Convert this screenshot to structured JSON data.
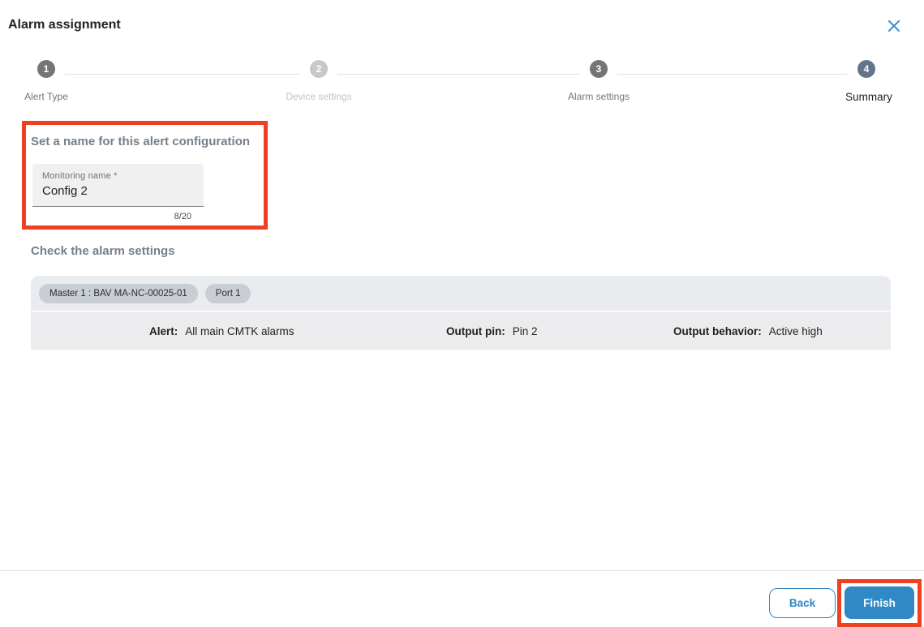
{
  "dialog": {
    "title": "Alarm assignment"
  },
  "stepper": {
    "steps": [
      {
        "number": "1",
        "label": "Alert Type",
        "state": "completed"
      },
      {
        "number": "2",
        "label": "Device settings",
        "state": "disabled"
      },
      {
        "number": "3",
        "label": "Alarm settings",
        "state": "completed"
      },
      {
        "number": "4",
        "label": "Summary",
        "state": "active"
      }
    ]
  },
  "name_section": {
    "heading": "Set a name for this alert configuration",
    "field": {
      "label": "Monitoring name *",
      "value": "Config 2",
      "counter": "8/20"
    }
  },
  "settings_section": {
    "heading": "Check the alarm settings",
    "chips": [
      "Master 1 : BAV MA-NC-00025-01",
      "Port 1"
    ],
    "details": [
      {
        "label": "Alert:",
        "value": "All main CMTK alarms"
      },
      {
        "label": "Output pin:",
        "value": "Pin 2"
      },
      {
        "label": "Output behavior:",
        "value": "Active high"
      }
    ]
  },
  "footer": {
    "back_label": "Back",
    "finish_label": "Finish"
  },
  "colors": {
    "accent_blue": "#3089c4",
    "annotation_red": "#ee4023",
    "step_completed": "#757575",
    "step_disabled": "#c8c8c8",
    "step_active": "#64748b",
    "card_background": "#e9ecef",
    "chip_background": "#c9ced4"
  }
}
